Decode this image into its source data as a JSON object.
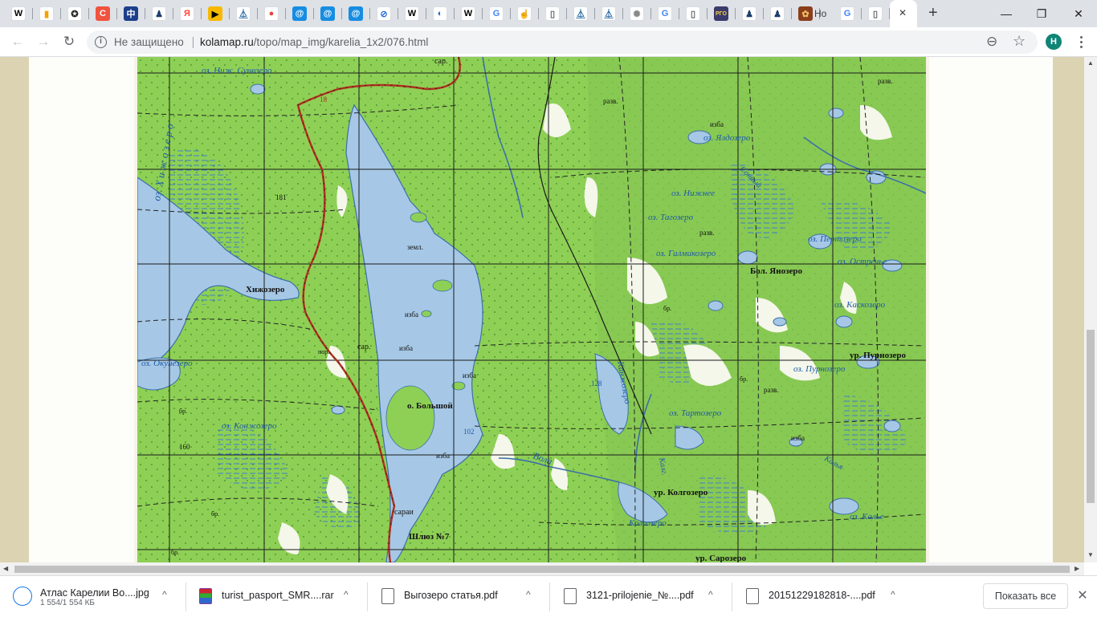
{
  "tabs": {
    "favicons": [
      {
        "name": "wikipedia-tab",
        "glyph": "W",
        "bg": "#ffffff",
        "fg": "#000000"
      },
      {
        "name": "chart-tab",
        "glyph": "▮",
        "bg": "#ffffff",
        "fg": "#f4a300"
      },
      {
        "name": "film-tab",
        "glyph": "✪",
        "bg": "#ffffff",
        "fg": "#222222"
      },
      {
        "name": "orange-tab",
        "glyph": "C",
        "bg": "#f0533e",
        "fg": "#ffffff"
      },
      {
        "name": "blue-glyph-tab",
        "glyph": "中",
        "bg": "#1b3f8b",
        "fg": "#ffffff"
      },
      {
        "name": "person-tab",
        "glyph": "♟",
        "bg": "#ffffff",
        "fg": "#1c3d6d"
      },
      {
        "name": "yandex-tab",
        "glyph": "Я",
        "bg": "#ffffff",
        "fg": "#f43"
      },
      {
        "name": "play-tab",
        "glyph": "▶",
        "bg": "#f6b900",
        "fg": "#000000"
      },
      {
        "name": "tower-tab",
        "glyph": "⏅",
        "bg": "#ffffff",
        "fg": "#1a5e9a"
      },
      {
        "name": "maps-tab",
        "glyph": "●",
        "bg": "#ffffff",
        "fg": "#e8453c"
      },
      {
        "name": "at-tab-1",
        "glyph": "@",
        "bg": "#168de2",
        "fg": "#ffffff"
      },
      {
        "name": "at-tab-2",
        "glyph": "@",
        "bg": "#168de2",
        "fg": "#ffffff"
      },
      {
        "name": "at-tab-3",
        "glyph": "@",
        "bg": "#168de2",
        "fg": "#ffffff"
      },
      {
        "name": "compass-tab",
        "glyph": "⊘",
        "bg": "#ffffff",
        "fg": "#2a6fd6"
      },
      {
        "name": "wikipedia-tab-2",
        "glyph": "W",
        "bg": "#ffffff",
        "fg": "#000000"
      },
      {
        "name": "globe-tab",
        "glyph": "◐",
        "bg": "#ffffff",
        "fg": "#1f6fbf"
      },
      {
        "name": "wikipedia-tab-3",
        "glyph": "W",
        "bg": "#ffffff",
        "fg": "#000000"
      },
      {
        "name": "google-tab-1",
        "glyph": "G",
        "bg": "#ffffff",
        "fg": "#4285f4"
      },
      {
        "name": "hand-tab",
        "glyph": "☝",
        "bg": "#ffffff",
        "fg": "#d69a00"
      },
      {
        "name": "page-tab-1",
        "glyph": "▯",
        "bg": "#ffffff",
        "fg": "#5f6368"
      },
      {
        "name": "tower-tab-2",
        "glyph": "⏅",
        "bg": "#ffffff",
        "fg": "#1a5e9a"
      },
      {
        "name": "tower-tab-3",
        "glyph": "⏅",
        "bg": "#ffffff",
        "fg": "#1a5e9a"
      },
      {
        "name": "emblem-tab",
        "glyph": "✺",
        "bg": "#ffffff",
        "fg": "#888888"
      },
      {
        "name": "google-tab-2",
        "glyph": "G",
        "bg": "#ffffff",
        "fg": "#4285f4"
      },
      {
        "name": "page-tab-2",
        "glyph": "▯",
        "bg": "#ffffff",
        "fg": "#5f6368"
      },
      {
        "name": "rgo-tab",
        "glyph": "РГО",
        "bg": "#3b3b6b",
        "fg": "#f7d14a"
      },
      {
        "name": "person-tab-2",
        "glyph": "♟",
        "bg": "#ffffff",
        "fg": "#1c3d6d"
      },
      {
        "name": "person-tab-3",
        "glyph": "♟",
        "bg": "#ffffff",
        "fg": "#1c3d6d"
      },
      {
        "name": "brown-tab",
        "glyph": "✿",
        "bg": "#8b3e1c",
        "fg": "#f0c060"
      }
    ],
    "text_tab_label": "Но",
    "after_text": [
      {
        "name": "google-tab-3",
        "glyph": "G",
        "bg": "#ffffff",
        "fg": "#4285f4"
      },
      {
        "name": "page-tab-3",
        "glyph": "▯",
        "bg": "#ffffff",
        "fg": "#5f6368"
      }
    ],
    "active_close": "✕",
    "new_tab": "+"
  },
  "window": {
    "minimize": "—",
    "maximize": "❐",
    "close": "✕"
  },
  "toolbar": {
    "back": "←",
    "forward": "→",
    "reload": "↻",
    "security_label": "Не защищено",
    "url_host": "kolamap.ru",
    "url_path": "/topo/map_img/karelia_1x2/076.html",
    "zoom_icon": "⊖",
    "star_icon": "☆",
    "avatar_letter": "H"
  },
  "map": {
    "labels": {
      "nizh_sunozero": "оз. Ниж. Сунозеро",
      "hizhozero_lake": "оз. Х и ж о з е р о",
      "hizhozero_village": "Хижозеро",
      "sar_top": "сар.",
      "sar_mid": "сар.",
      "saray": "сараи",
      "izba_1": "изба",
      "izba_2": "изба",
      "izba_3": "изба",
      "izba_4": "изба",
      "izba_5": "изба",
      "izba_6": "изба",
      "zeml": "земл.",
      "por": "пор.",
      "o_bolshoy": "о. Большой",
      "okunozero": "оз. Окунёзеро",
      "konzhozero": "оз. Конжозеро",
      "shluz": "Шлюз №7",
      "vola": "Вола",
      "yaldozero": "оз. Ялдозеро",
      "nizhnee": "оз. Нижнее",
      "tagozero": "оз. Тагозеро",
      "galmikozero": "оз. Галмикозеро",
      "bol_yanozero": "Бол. Янозеро",
      "pertozero": "оз. Пертозеро",
      "ostrechye": "оз. Остречье",
      "kaskozero": "оз. Каскозеро",
      "ur_purnozero": "ур. Пурнозеро",
      "purnozero": "оз. Пурнозеро",
      "tartozero": "оз. Тартозеро",
      "kanzhozero": "Канжозеро",
      "ur_kolgozero": "ур. Колгозеро",
      "kolgozero": "Колгозеро",
      "kalye": "оз. Калье",
      "ur_sarozero": "ур. Сарозеро",
      "kalya_river": "Калья",
      "sonnyi": "Сонный",
      "razv_1": "разв.",
      "razv_2": "разв.",
      "razv_3": "разв.",
      "razv_4": "разв.",
      "br_1": "бр.",
      "br_2": "бр.",
      "br_3": "бр.",
      "br_4": "бр.",
      "br_5": "бр.",
      "road_number": "18",
      "h181": "181",
      "h160": "160",
      "h128": "128",
      "h102": "102",
      "kalg": "Калг."
    }
  },
  "downloads": [
    {
      "name": "Атлас Карелии Во....jpg",
      "sub": "1 554/1 554 КБ",
      "chevron": "^"
    },
    {
      "name": "turist_pasport_SMR....rar",
      "chevron": "^"
    },
    {
      "name": "Выгозеро статья.pdf",
      "chevron": "^"
    },
    {
      "name": "3121-prilojenie_№....pdf",
      "chevron": "^"
    },
    {
      "name": "20151229182818-....pdf",
      "chevron": "^"
    }
  ],
  "shelf": {
    "show_all": "Показать все",
    "close": "✕"
  }
}
